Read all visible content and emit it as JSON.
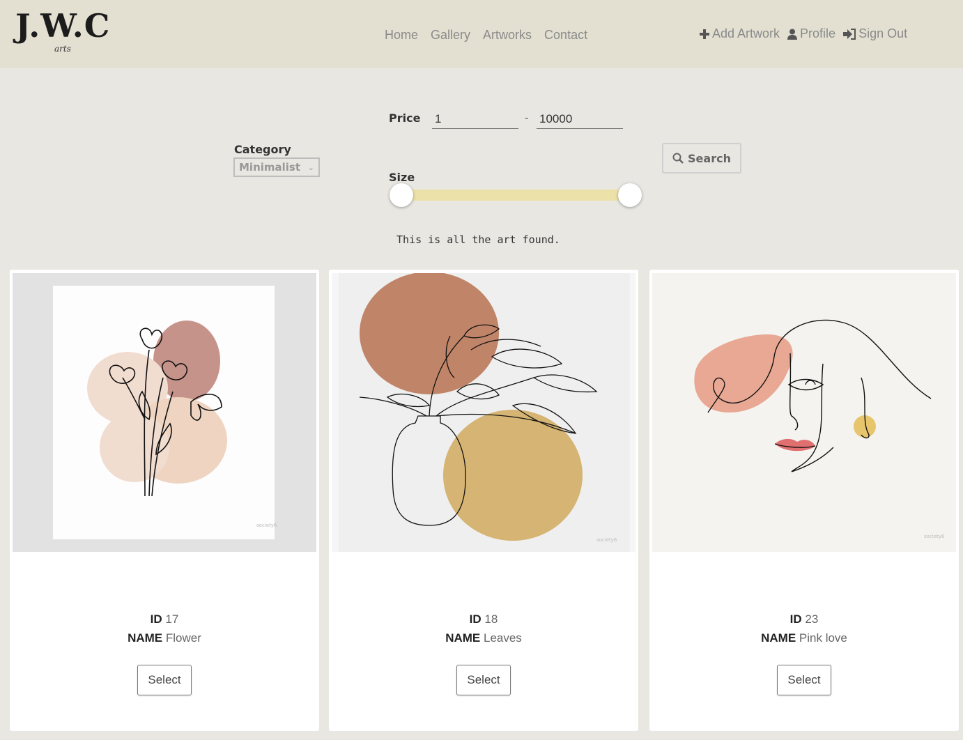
{
  "header": {
    "logo": "J.W.C",
    "logo_sub": "arts",
    "nav": [
      "Home",
      "Gallery",
      "Artworks",
      "Contact"
    ],
    "actions": [
      {
        "label": "Add Artwork",
        "icon": "plus-icon"
      },
      {
        "label": "Profile",
        "icon": "user-icon"
      },
      {
        "label": "Sign Out",
        "icon": "sign-out-icon"
      }
    ]
  },
  "filters": {
    "category_label": "Category",
    "category_value": "Minimalist",
    "price_label": "Price",
    "price_min": "1",
    "price_sep": "-",
    "price_max": "10000",
    "size_label": "Size",
    "size_range": [
      0,
      1
    ],
    "search_label": "Search",
    "result_text": "This is all the art found."
  },
  "artworks": [
    {
      "id_label": "ID",
      "id": "17",
      "name_label": "NAME",
      "name": "Flower",
      "button": "Select"
    },
    {
      "id_label": "ID",
      "id": "18",
      "name_label": "NAME",
      "name": "Leaves",
      "button": "Select"
    },
    {
      "id_label": "ID",
      "id": "23",
      "name_label": "NAME",
      "name": "Pink love",
      "button": "Select"
    }
  ],
  "colors": {
    "header_bg": "#e3e0d2",
    "page_bg": "#e8e7e2",
    "slider_track": "#ece1a9"
  }
}
